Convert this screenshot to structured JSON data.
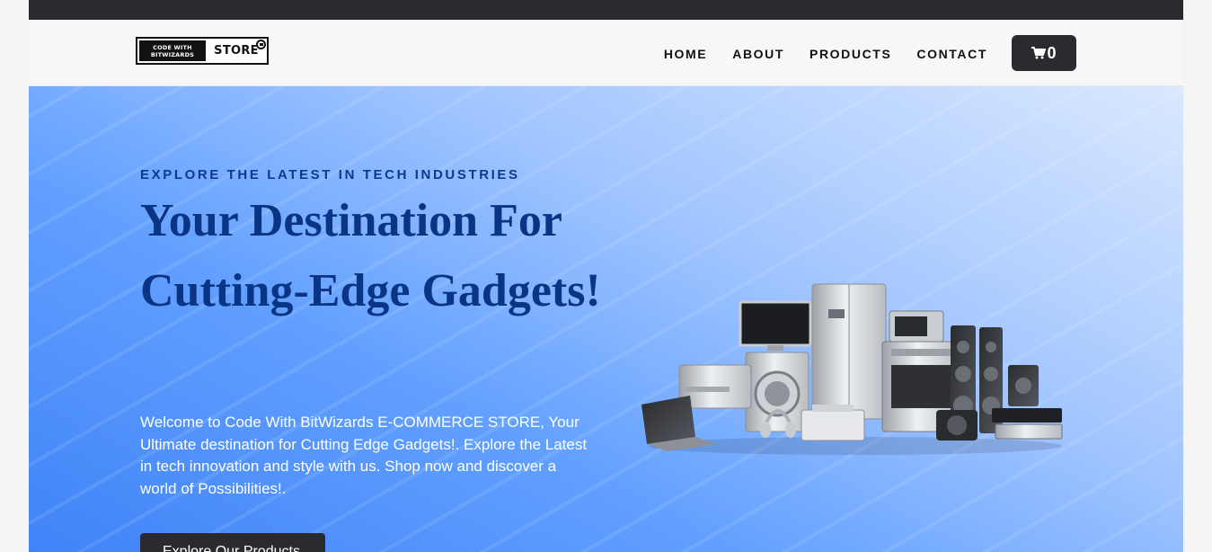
{
  "nav": {
    "logo_line1": "CODE WITH",
    "logo_line2": "BITWIZARDS",
    "logo_store": "STORE",
    "links": [
      "HOME",
      "ABOUT",
      "PRODUCTS",
      "CONTACT"
    ],
    "cart_count": "0"
  },
  "hero": {
    "eyebrow": "EXPLORE THE LATEST IN TECH INDUSTRIES",
    "headline": "Your Destination For Cutting-Edge Gadgets!",
    "description": "Welcome to Code With BitWizards E-COMMERCE STORE, Your Ultimate destination for Cutting Edge Gadgets!. Explore the Latest in tech innovation and style with us. Shop now and discover a world of Possibilities!.",
    "cta": "Explore Our Products"
  },
  "colors": {
    "topbar": "#2b2a2f",
    "heading_blue": "#0a3585",
    "hero_gradient_start": "#3f83f7",
    "hero_gradient_end": "#dae8ff"
  },
  "icons": {
    "cart": "shopping-cart-icon"
  }
}
